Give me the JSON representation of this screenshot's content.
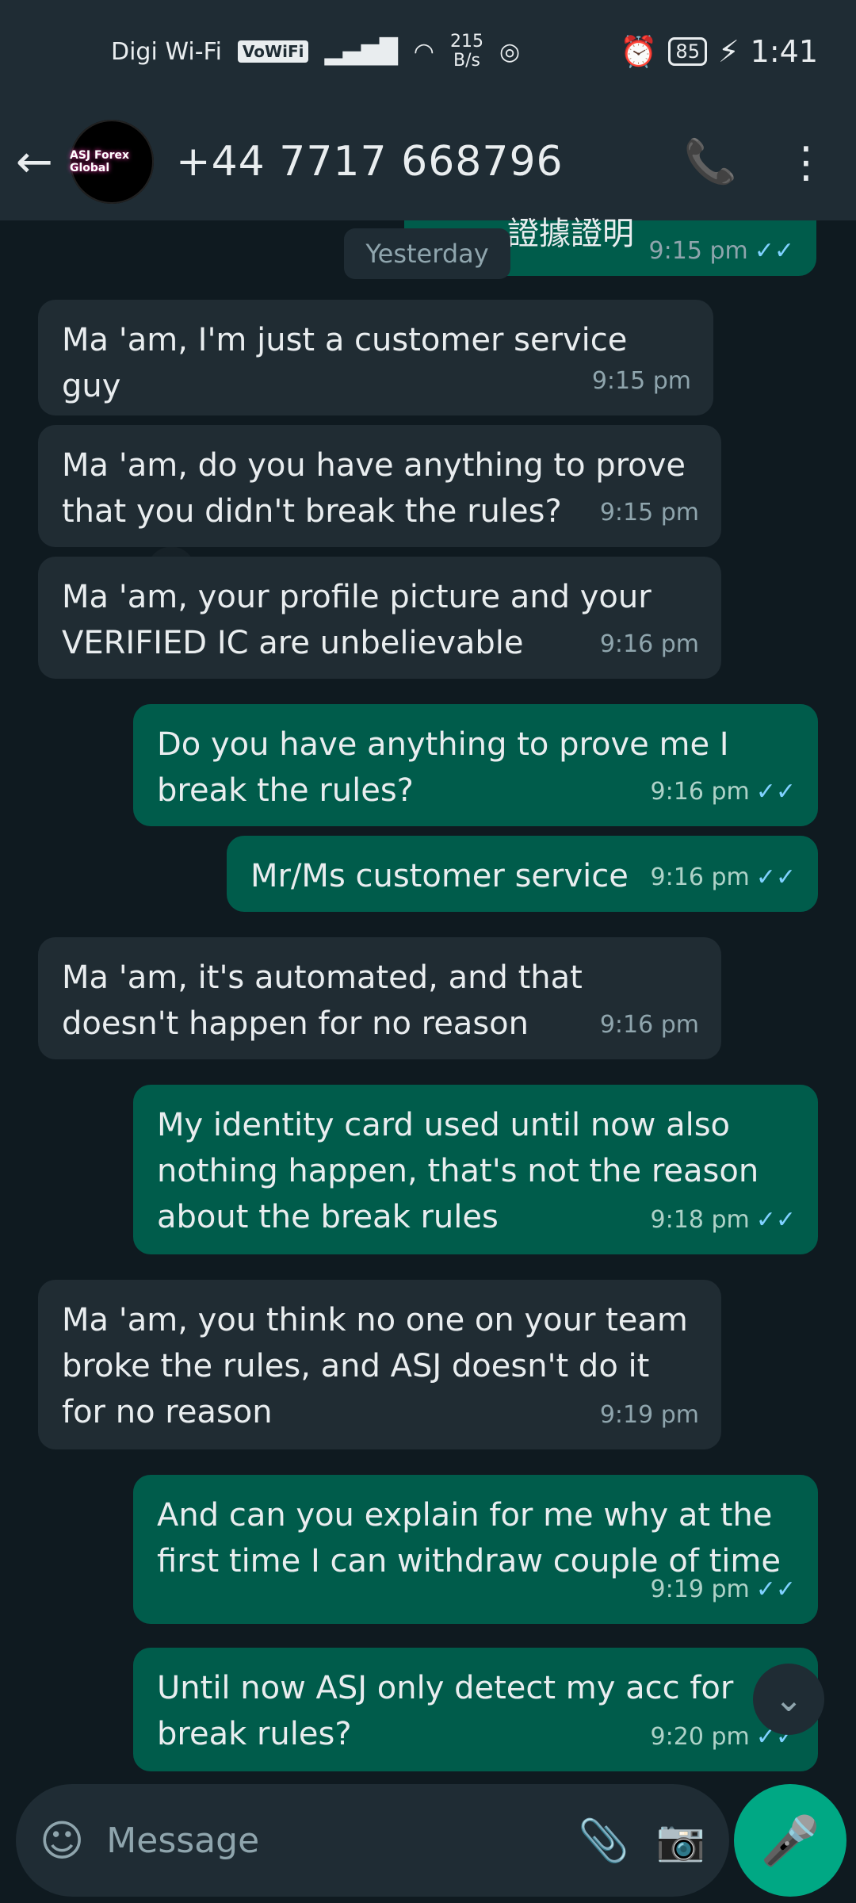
{
  "status_bar": {
    "carrier": "Digi Wi-Fi",
    "vowifi": "VoWiFi",
    "speed_value": "215",
    "speed_unit": "B/s",
    "battery": "85",
    "time": "1:41"
  },
  "header": {
    "contact": "+44 7717 668796",
    "avatar_text": "ASJ Forex Global"
  },
  "chat": {
    "partial_top_text": "證據證明",
    "partial_top_time": "9:15 pm",
    "date_chip": "Yesterday",
    "messages": [
      {
        "text": "Ma 'am, I'm just a customer service guy",
        "time": "9:15 pm"
      },
      {
        "text": "Ma 'am, do you have anything to prove that you didn't break the rules?",
        "time": "9:15 pm"
      },
      {
        "text": "Ma 'am, your profile picture and your VERIFIED IC are unbelievable",
        "time": "9:16 pm"
      },
      {
        "text": "Do you have anything to prove me I break the rules?",
        "time": "9:16 pm"
      },
      {
        "text": "Mr/Ms customer service",
        "time": "9:16 pm"
      },
      {
        "text": "Ma 'am, it's automated, and that doesn't happen for no reason",
        "time": "9:16 pm"
      },
      {
        "text": "My identity card used until now also nothing happen, that's not the reason about  the break rules",
        "time": "9:18 pm"
      },
      {
        "text": "Ma 'am, you think no one on your team broke the rules, and ASJ doesn't do it for no reason",
        "time": "9:19 pm"
      },
      {
        "text": "And can you explain for me why at the first time I can withdraw couple of time",
        "time": "9:19 pm"
      },
      {
        "text": "Until now ASJ only detect my acc for break rules?",
        "time": "9:20 pm"
      }
    ]
  },
  "input": {
    "placeholder": "Message"
  },
  "icons": {
    "back": "arrow-left-icon",
    "call_add": "phone-plus-icon",
    "menu": "kebab-menu-icon",
    "emoji": "smiley-icon",
    "attach": "paperclip-icon",
    "camera": "camera-icon",
    "mic": "microphone-icon",
    "scroll": "chevron-double-down-icon"
  },
  "colors": {
    "incoming_bubble": "#202c33",
    "outgoing_bubble": "#005c4b",
    "accent": "#00a884",
    "read_ticks": "#7fd1ff"
  }
}
